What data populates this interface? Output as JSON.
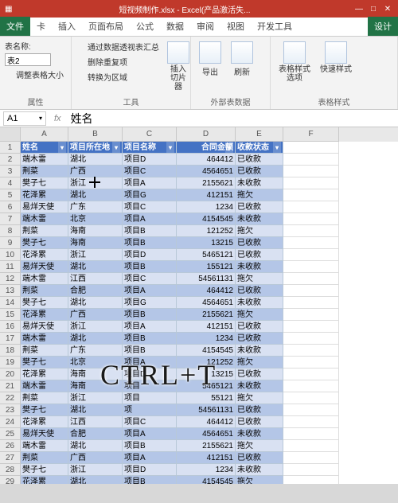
{
  "window": {
    "title": "短视频制作.xlsx - Excel(产品激活失...",
    "min": "—",
    "max": "□",
    "close": "✕"
  },
  "menu": {
    "file": "文件",
    "items": [
      "卡",
      "插入",
      "页面布局",
      "公式",
      "数据",
      "审阅",
      "视图",
      "开发工具"
    ],
    "active": "设计"
  },
  "ribbon": {
    "props": {
      "name_lbl": "表名称:",
      "name_val": "表2",
      "resize": "调整表格大小",
      "grp": "属性"
    },
    "tools": {
      "pivot": "通过数据透视表汇总",
      "dedupe": "删除重复项",
      "range": "转换为区域",
      "slicer": "插入切片器",
      "grp": "工具"
    },
    "ext": {
      "export": "导出",
      "refresh": "刷新",
      "grp": "外部表数据"
    },
    "style": {
      "opts": "表格样式选项",
      "quick": "快速样式",
      "grp": "表格样式"
    }
  },
  "formula": {
    "cell": "A1",
    "val": "姓名"
  },
  "cols": [
    "A",
    "B",
    "C",
    "D",
    "E",
    "F"
  ],
  "headers": [
    "姓名",
    "项目所在地",
    "项目名称",
    "合同金额",
    "收款状态"
  ],
  "rows": [
    [
      "端木雷",
      "湖北",
      "项目D",
      "464412",
      "已收款"
    ],
    [
      "荆菜",
      "广西",
      "项目C",
      "4564651",
      "已收款"
    ],
    [
      "樊子七",
      "浙江",
      "项目A",
      "2155621",
      "未收款"
    ],
    [
      "花泽累",
      "湖北",
      "项目G",
      "412151",
      "拖欠"
    ],
    [
      "易烊天使",
      "广东",
      "项目C",
      "1234",
      "已收款"
    ],
    [
      "端木雷",
      "北京",
      "项目A",
      "4154545",
      "未收款"
    ],
    [
      "荆菜",
      "海南",
      "项目B",
      "121252",
      "拖欠"
    ],
    [
      "樊子七",
      "海南",
      "项目B",
      "13215",
      "已收款"
    ],
    [
      "花泽累",
      "浙江",
      "项目D",
      "5465121",
      "已收款"
    ],
    [
      "易烊天使",
      "湖北",
      "项目B",
      "155121",
      "未收款"
    ],
    [
      "端木雷",
      "江西",
      "项目C",
      "54561131",
      "拖欠"
    ],
    [
      "荆菜",
      "合肥",
      "项目A",
      "464412",
      "已收款"
    ],
    [
      "樊子七",
      "湖北",
      "项目G",
      "4564651",
      "未收款"
    ],
    [
      "花泽累",
      "广西",
      "项目B",
      "2155621",
      "拖欠"
    ],
    [
      "易烊天使",
      "浙江",
      "项目A",
      "412151",
      "已收款"
    ],
    [
      "端木雷",
      "湖北",
      "项目B",
      "1234",
      "已收款"
    ],
    [
      "荆菜",
      "广东",
      "项目B",
      "4154545",
      "未收款"
    ],
    [
      "樊子七",
      "北京",
      "项目A",
      "121252",
      "拖欠"
    ],
    [
      "花泽累",
      "海南",
      "项目D",
      "13215",
      "已收款"
    ],
    [
      "端木雷",
      "海南",
      "项目",
      "5465121",
      "未收款"
    ],
    [
      "荆菜",
      "浙江",
      "项目",
      "55121",
      "拖欠"
    ],
    [
      "樊子七",
      "湖北",
      "项",
      "54561131",
      "已收款"
    ],
    [
      "花泽累",
      "江西",
      "项目C",
      "464412",
      "已收款"
    ],
    [
      "易烊天使",
      "合肥",
      "项目A",
      "4564651",
      "未收款"
    ],
    [
      "端木雷",
      "湖北",
      "项目B",
      "2155621",
      "拖欠"
    ],
    [
      "荆菜",
      "广西",
      "项目A",
      "412151",
      "已收款"
    ],
    [
      "樊子七",
      "浙江",
      "项目D",
      "1234",
      "未收款"
    ],
    [
      "花泽累",
      "湖北",
      "项目B",
      "4154545",
      "拖欠"
    ]
  ],
  "overlay": "CTRL+T"
}
